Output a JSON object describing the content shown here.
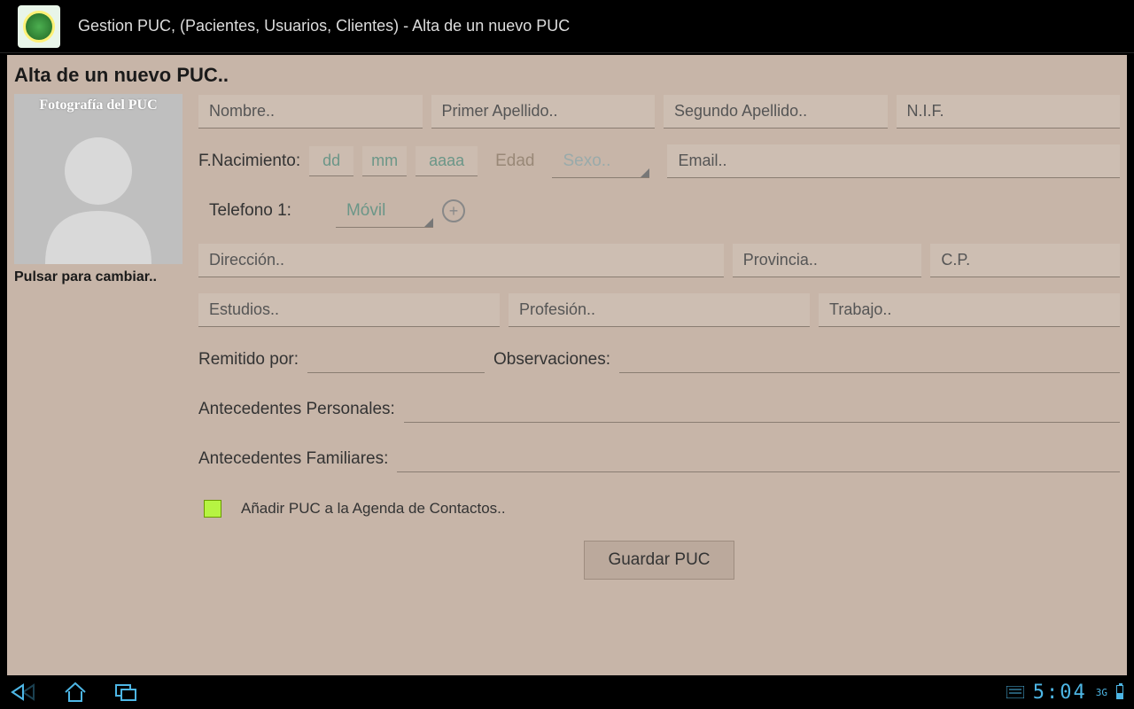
{
  "actionbar": {
    "title": "Gestion PUC, (Pacientes, Usuarios, Clientes) - Alta de un nuevo PUC"
  },
  "page": {
    "title": "Alta de un nuevo PUC.."
  },
  "photo": {
    "label": "Fotografía del PUC",
    "caption": "Pulsar para cambiar.."
  },
  "fields": {
    "nombre": "Nombre..",
    "apellido1": "Primer Apellido..",
    "apellido2": "Segundo Apellido..",
    "nif": "N.I.F.",
    "fnac_label": "F.Nacimiento:",
    "dd": "dd",
    "mm": "mm",
    "aaaa": "aaaa",
    "edad": "Edad",
    "sexo": "Sexo..",
    "email": "Email..",
    "tel_label": "Telefono 1:",
    "tel_type": "Móvil",
    "direccion": "Dirección..",
    "provincia": "Provincia..",
    "cp": "C.P.",
    "estudios": "Estudios..",
    "profesion": "Profesión..",
    "trabajo": "Trabajo..",
    "remitido_label": "Remitido por:",
    "observ_label": "Observaciones:",
    "antec_pers_label": "Antecedentes Personales:",
    "antec_fam_label": "Antecedentes Familiares:"
  },
  "checkbox": {
    "label": "Añadir PUC a la Agenda de Contactos.."
  },
  "buttons": {
    "save": "Guardar PUC"
  },
  "statusbar": {
    "time": "5:04",
    "network": "3G"
  }
}
